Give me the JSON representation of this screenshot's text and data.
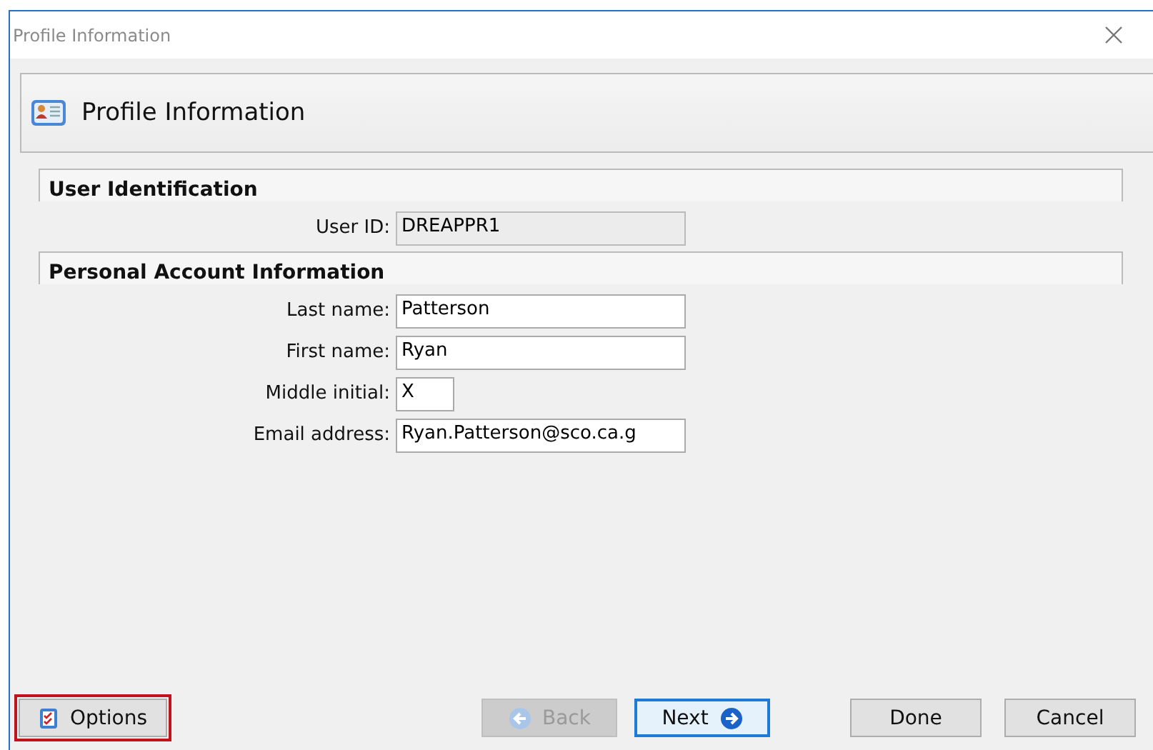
{
  "window": {
    "title": "Profile Information"
  },
  "header": {
    "title": "Profile Information"
  },
  "sections": [
    {
      "title": "User Identification",
      "fields": [
        {
          "label": "User ID:",
          "value": "DREAPPR1",
          "disabled": true,
          "kind": "text"
        }
      ]
    },
    {
      "title": "Personal Account Information",
      "fields": [
        {
          "label": "Last name:",
          "value": "Patterson",
          "disabled": false,
          "kind": "text"
        },
        {
          "label": "First name:",
          "value": "Ryan",
          "disabled": false,
          "kind": "text"
        },
        {
          "label": "Middle initial:",
          "value": "X",
          "disabled": false,
          "kind": "initial"
        },
        {
          "label": "Email address:",
          "value": "Ryan.Patterson@sco.ca.g",
          "disabled": false,
          "kind": "text"
        }
      ]
    }
  ],
  "buttons": [
    {
      "label": "Options",
      "kind": "options",
      "disabled": false,
      "focused": false,
      "highlighted": true
    },
    {
      "label": "Back",
      "kind": "back",
      "disabled": true,
      "focused": false,
      "highlighted": false
    },
    {
      "label": "Next",
      "kind": "next",
      "disabled": false,
      "focused": true,
      "highlighted": false
    },
    {
      "label": "Done",
      "kind": "plain",
      "disabled": false,
      "focused": false,
      "highlighted": false
    },
    {
      "label": "Cancel",
      "kind": "plain",
      "disabled": false,
      "focused": false,
      "highlighted": false
    }
  ]
}
